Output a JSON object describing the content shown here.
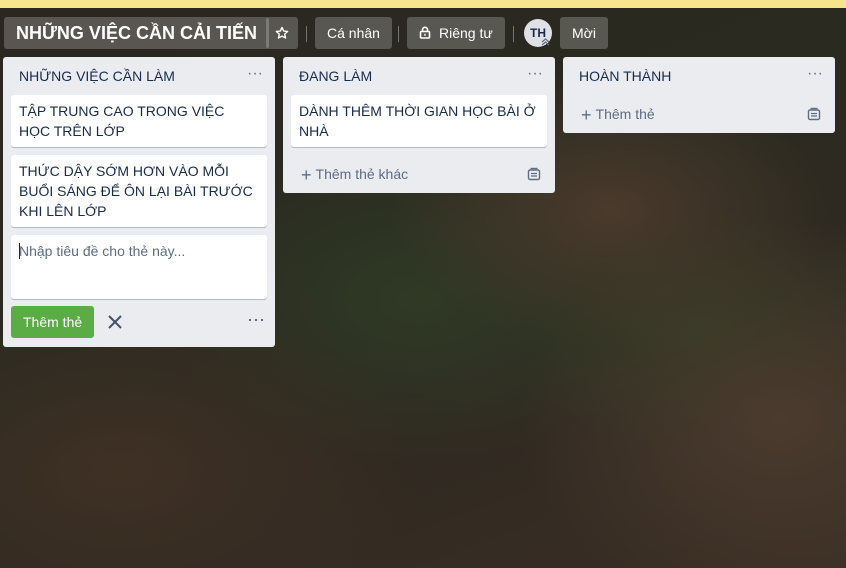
{
  "header": {
    "board_title": "NHỮNG VIỆC CẦN CẢI TIẾN",
    "star_icon": "star-icon",
    "personal_label": "Cá nhân",
    "private_label": "Riêng tư",
    "private_icon": "lock-icon",
    "avatar_initials": "TH",
    "invite_label": "Mời"
  },
  "lists": [
    {
      "title": "NHỮNG VIỆC CẦN LÀM",
      "menu": "···",
      "cards": [
        "TẬP TRUNG CAO TRONG VIỆC HỌC TRÊN LỚP",
        "THỨC DẬY SỚM HƠN VÀO MỖI BUỔI SÁNG ĐỂ ÔN LẠI BÀI TRƯỚC KHI LÊN LỚP"
      ],
      "composer": {
        "placeholder": "Nhập tiêu đề cho thẻ này...",
        "add_button": "Thêm thẻ",
        "more": "···"
      }
    },
    {
      "title": "ĐANG LÀM",
      "menu": "···",
      "cards": [
        "DÀNH THÊM THỜI GIAN HỌC BÀI Ở NHÀ"
      ],
      "add_label": "Thêm thẻ khác"
    },
    {
      "title": "HOÀN THÀNH",
      "menu": "···",
      "cards": [],
      "add_label": "Thêm thẻ"
    }
  ],
  "colors": {
    "accent_green": "#5aac44",
    "list_bg": "#ebecf0",
    "top_banner": "#f6e58d"
  }
}
